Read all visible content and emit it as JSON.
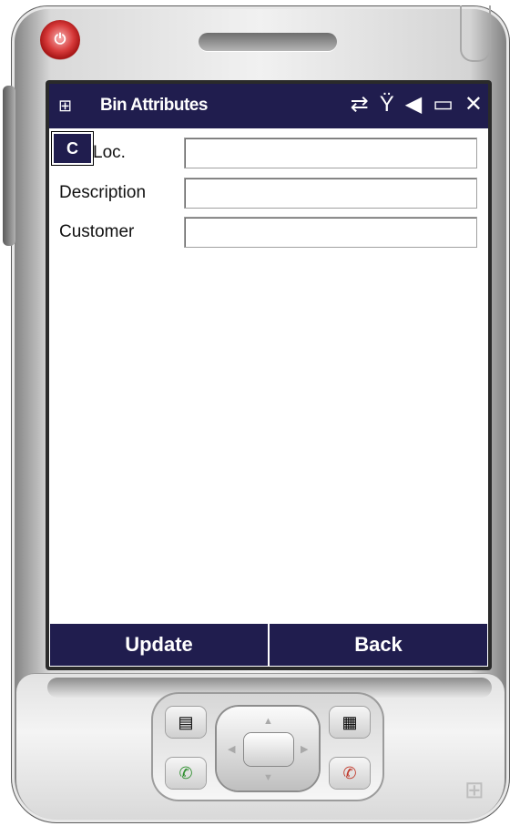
{
  "window": {
    "title": "Bin Attributes"
  },
  "tray": {
    "icons": [
      "sync-icon",
      "signal-off-icon",
      "speaker-mute-icon",
      "battery-icon",
      "close-icon"
    ]
  },
  "form": {
    "clear_button_label": "C",
    "location_label": "Loc.",
    "location_value": "",
    "description_label": "Description",
    "description_value": "",
    "customer_label": "Customer",
    "customer_value": ""
  },
  "softkeys": {
    "left_label": "Update",
    "right_label": "Back"
  },
  "colors": {
    "titlebar": "#201d4e",
    "softkey_bar": "#201d4e"
  }
}
